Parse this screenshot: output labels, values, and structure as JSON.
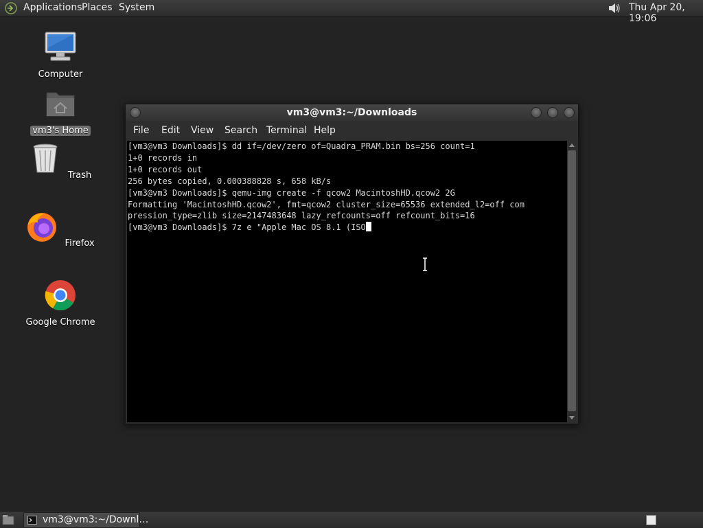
{
  "top_panel": {
    "menus": [
      "Applications",
      "Places",
      "System"
    ],
    "clock": "Thu Apr 20, 19:06",
    "volume_icon": "speaker-icon"
  },
  "desktop": {
    "icons": [
      {
        "label": "Computer",
        "icon": "computer-icon"
      },
      {
        "label": "vm3's Home",
        "icon": "home-folder-icon"
      },
      {
        "label": "Trash",
        "icon": "trash-icon"
      },
      {
        "label": "Firefox",
        "icon": "firefox-icon"
      },
      {
        "label": "Google Chrome",
        "icon": "chrome-icon"
      }
    ]
  },
  "window": {
    "title": "vm3@vm3:~/Downloads",
    "menu": [
      "File",
      "Edit",
      "View",
      "Search",
      "Terminal",
      "Help"
    ],
    "terminal_lines": [
      "[vm3@vm3 Downloads]$ dd if=/dev/zero of=Quadra_PRAM.bin bs=256 count=1",
      "1+0 records in",
      "1+0 records out",
      "256 bytes copied, 0.000388828 s, 658 kB/s",
      "[vm3@vm3 Downloads]$ qemu-img create -f qcow2 MacintoshHD.qcow2 2G",
      "Formatting 'MacintoshHD.qcow2', fmt=qcow2 cluster_size=65536 extended_l2=off com",
      "pression_type=zlib size=2147483648 lazy_refcounts=off refcount_bits=16",
      "[vm3@vm3 Downloads]$ 7z e \"Apple Mac OS 8.1 (ISO"
    ]
  },
  "taskbar": {
    "task_label": "vm3@vm3:~/Downl…"
  },
  "colors": {
    "desktop_bg": "#232323",
    "terminal_bg": "#000000",
    "terminal_fg": "#d8d8d8"
  }
}
